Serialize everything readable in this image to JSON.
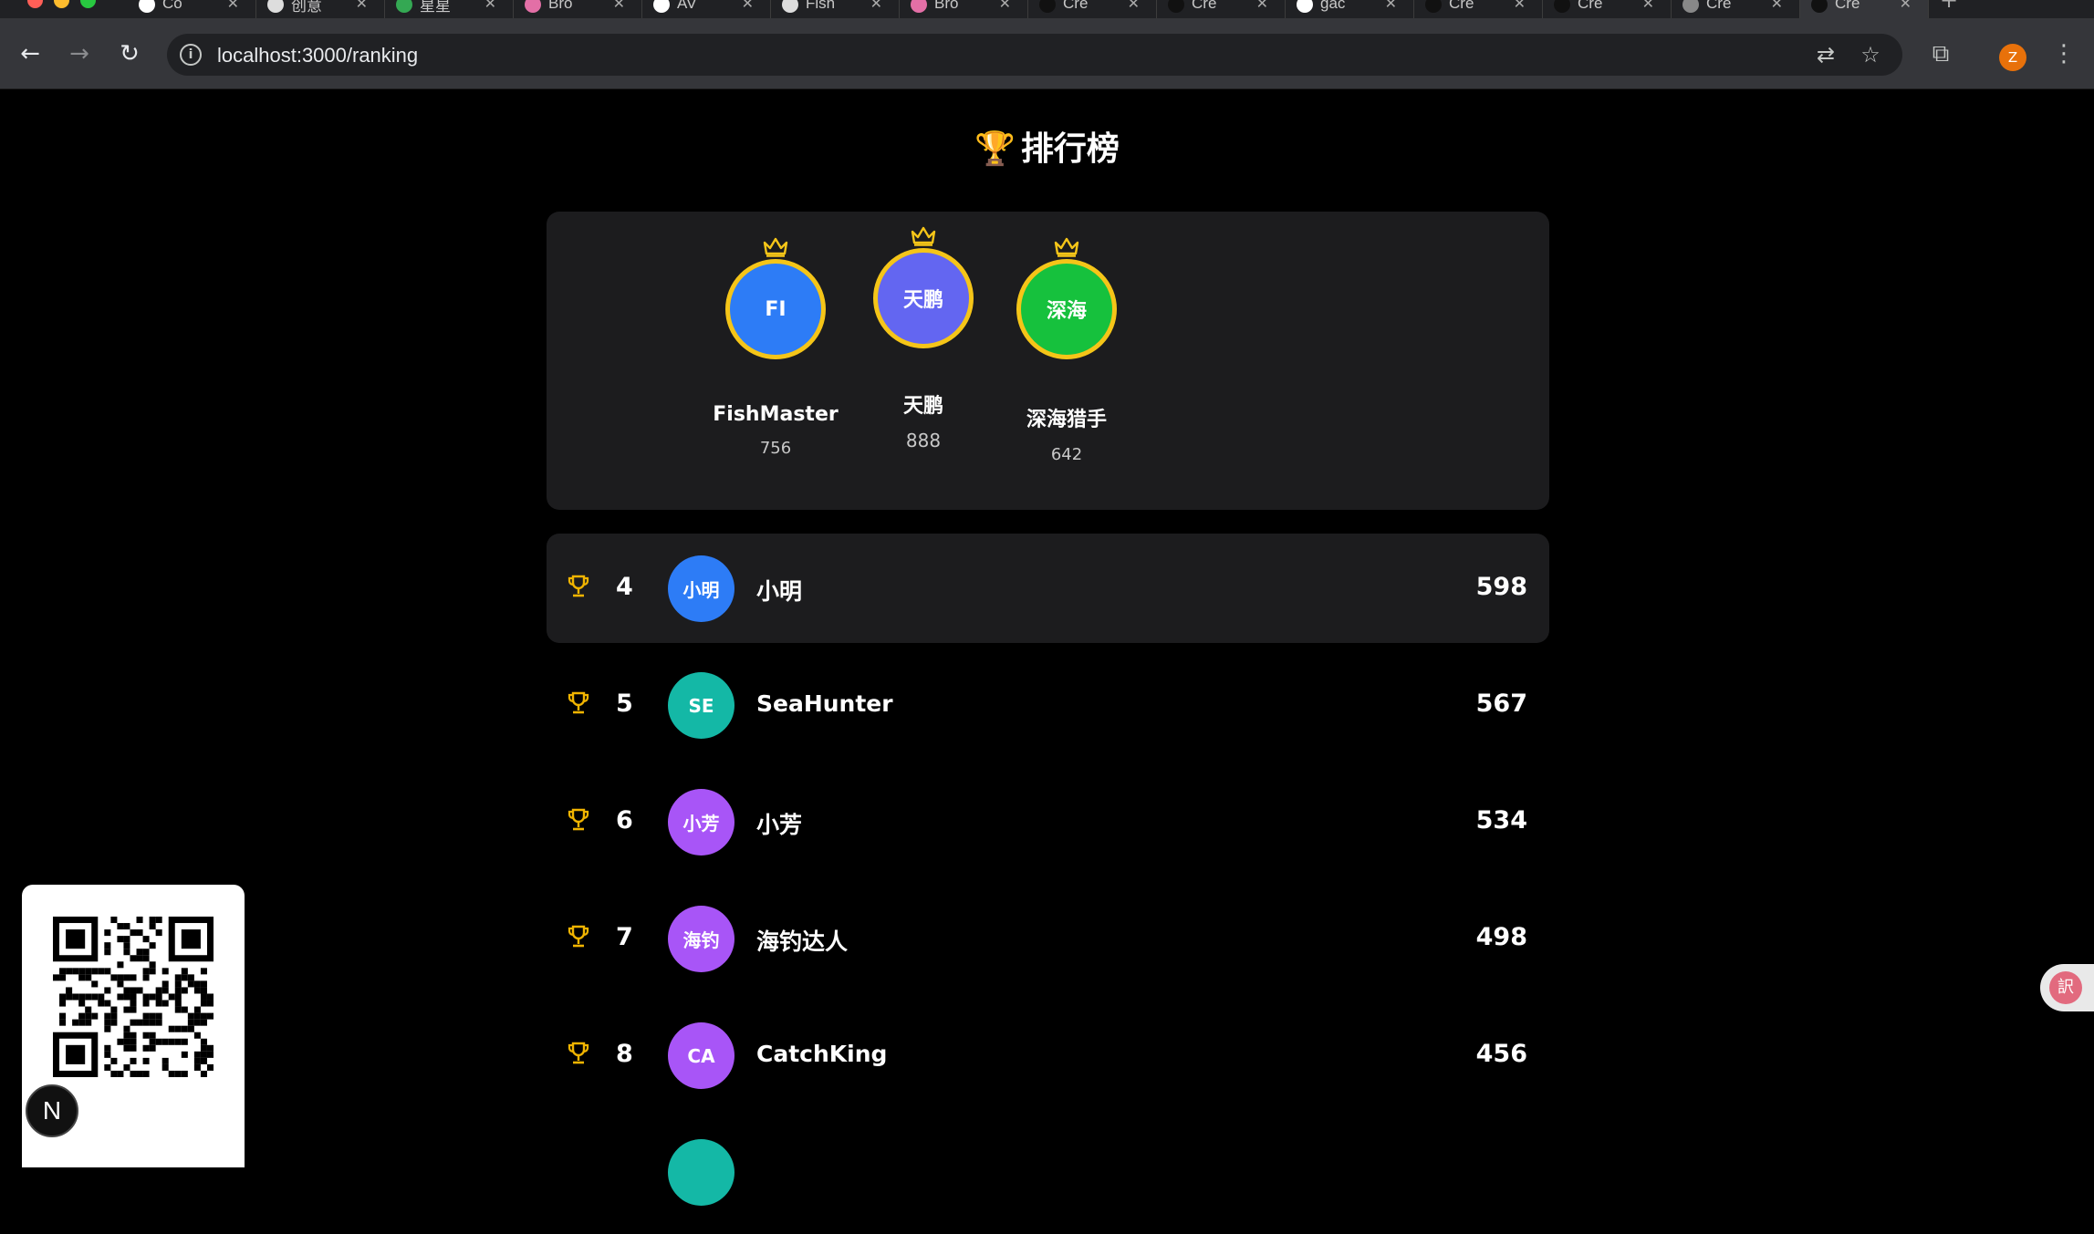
{
  "browser": {
    "tabs": [
      {
        "label": "Co",
        "icon": "x-logo-icon",
        "color": "#ffffff"
      },
      {
        "label": "创意",
        "icon": "chatgpt-icon",
        "color": "#dddddd"
      },
      {
        "label": "星星",
        "icon": "green-circle-icon",
        "color": "#34a853"
      },
      {
        "label": "Bro",
        "icon": "pink-circle-icon",
        "color": "#e36fa6"
      },
      {
        "label": "AV",
        "icon": "cursor-icon",
        "color": "#ffffff"
      },
      {
        "label": "Fish",
        "icon": "chatgpt-icon",
        "color": "#dddddd"
      },
      {
        "label": "Bro",
        "icon": "pink-circle-icon",
        "color": "#e36fa6"
      },
      {
        "label": "Cre",
        "icon": "dark-circle-icon",
        "color": "#111111"
      },
      {
        "label": "Cre",
        "icon": "dark-circle-icon",
        "color": "#111111"
      },
      {
        "label": "gac",
        "icon": "github-icon",
        "color": "#ffffff"
      },
      {
        "label": "Cre",
        "icon": "dark-circle-icon",
        "color": "#111111"
      },
      {
        "label": "Cre",
        "icon": "dark-circle-icon",
        "color": "#111111"
      },
      {
        "label": "Cre",
        "icon": "chatgpt-icon",
        "color": "#888888"
      },
      {
        "label": "Cre",
        "icon": "dark-circle-icon",
        "color": "#111111",
        "active": true
      }
    ],
    "url": "localhost:3000/ranking",
    "profile_initial": "Z"
  },
  "page": {
    "title": "排行榜",
    "title_icon": "trophy-icon"
  },
  "podium": [
    {
      "place": 2,
      "initials": "FI",
      "name": "FishMaster",
      "score": "756",
      "color": "#2d7cf6"
    },
    {
      "place": 1,
      "initials": "天鹏",
      "name": "天鹏",
      "score": "888",
      "color": "#6366f1"
    },
    {
      "place": 3,
      "initials": "深海",
      "name": "深海猎手",
      "score": "642",
      "color": "#16c13d"
    }
  ],
  "ranking": [
    {
      "rank": "4",
      "initials": "小明",
      "name": "小明",
      "score": "598",
      "color": "#2d7cf6",
      "highlight": true
    },
    {
      "rank": "5",
      "initials": "SE",
      "name": "SeaHunter",
      "score": "567",
      "color": "#14b8a6"
    },
    {
      "rank": "6",
      "initials": "小芳",
      "name": "小芳",
      "score": "534",
      "color": "#a855f7"
    },
    {
      "rank": "7",
      "initials": "海钓",
      "name": "海钓达人",
      "score": "498",
      "color": "#a855f7"
    },
    {
      "rank": "8",
      "initials": "CA",
      "name": "CatchKing",
      "score": "456",
      "color": "#a855f7"
    },
    {
      "rank": "",
      "initials": "",
      "name": "",
      "score": "",
      "color": "#14b8a6"
    }
  ],
  "colors": {
    "gold": "#f5c518",
    "trophy": "#f1b400",
    "card_bg": "#1c1c1e"
  },
  "overlays": {
    "next_badge": "N",
    "translate_icon": "translate-icon"
  }
}
